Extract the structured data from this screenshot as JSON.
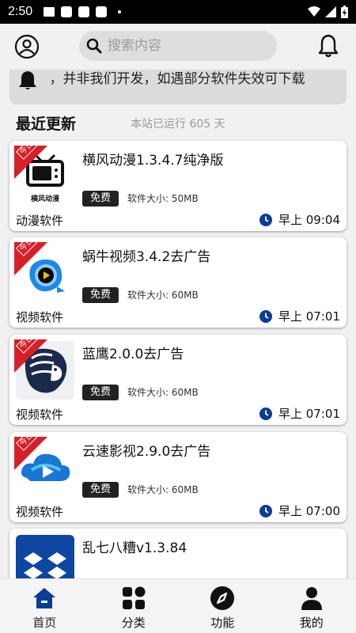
{
  "status_bar": {
    "time": "2:50"
  },
  "header": {
    "search_placeholder": "搜索内容",
    "icons": {
      "left": "user-circle-icon",
      "right": "bell-icon"
    }
  },
  "notice": {
    "text": "ﾐ，并非我们开发，如遇部分软件失效可下载"
  },
  "section": {
    "title": "最近更新",
    "uptime": "本站已运行 605 天"
  },
  "ribbon_label": "今日",
  "colors": {
    "accent": "#0b3d91",
    "ribbon": "#d71f27",
    "badge": "#222222"
  },
  "apps": [
    {
      "title": "横风动漫1.3.4.7纯净版",
      "badge": "免费",
      "size": "软件大小: 50MB",
      "category": "动漫软件",
      "time": "早上 09:04",
      "icon": "tv-icon",
      "icon_caption": "横风动漫",
      "ribbon": true
    },
    {
      "title": "蜗牛视频3.4.2去广告",
      "badge": "免费",
      "size": "软件大小: 60MB",
      "category": "视频软件",
      "time": "早上 07:01",
      "icon": "snail-video-icon",
      "ribbon": true
    },
    {
      "title": "蓝鹰2.0.0去广告",
      "badge": "免费",
      "size": "软件大小: 60MB",
      "category": "视频软件",
      "time": "早上 07:01",
      "icon": "eagle-icon",
      "ribbon": true
    },
    {
      "title": "云速影视2.9.0去广告",
      "badge": "免费",
      "size": "软件大小: 60MB",
      "category": "视频软件",
      "time": "早上 07:00",
      "icon": "cloud-play-icon",
      "ribbon": true
    },
    {
      "title": "乱七八糟v1.3.84",
      "icon": "dropbox-icon",
      "ribbon": false
    }
  ],
  "bottom_nav": [
    {
      "label": "首页",
      "icon": "home-icon",
      "active": true
    },
    {
      "label": "分类",
      "icon": "grid-icon",
      "active": false
    },
    {
      "label": "功能",
      "icon": "compass-icon",
      "active": false
    },
    {
      "label": "我的",
      "icon": "person-icon",
      "active": false
    }
  ]
}
